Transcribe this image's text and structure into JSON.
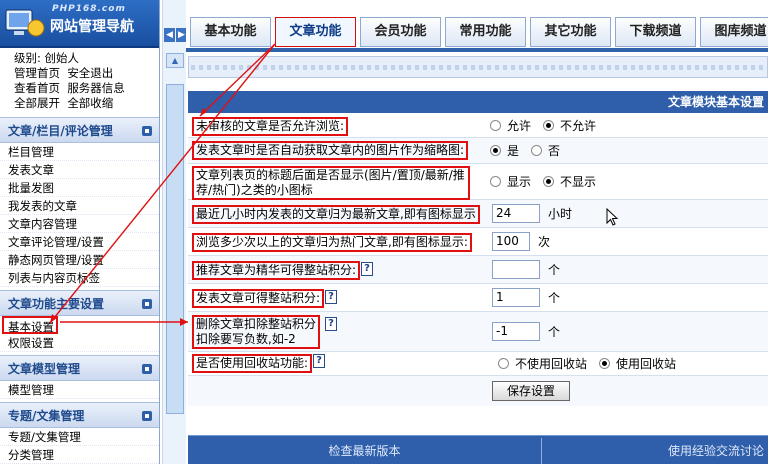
{
  "logo": {
    "site": "PHP168.com",
    "title": "网站管理导航"
  },
  "user": {
    "level_label": "级别: 创始人",
    "links_row1": [
      "管理首页",
      "安全退出"
    ],
    "links_row2": [
      "查看首页",
      "服务器信息"
    ],
    "links_row3": [
      "全部展开",
      "全部收缩"
    ]
  },
  "sidebar": {
    "sections": [
      {
        "title": "文章/栏目/评论管理",
        "items": [
          "栏目管理",
          "发表文章",
          "批量发图",
          "我发表的文章",
          "文章内容管理",
          "文章评论管理/设置",
          "静态网页管理/设置",
          "列表与内容页标签"
        ]
      },
      {
        "title": "文章功能主要设置",
        "items": [
          "基本设置",
          "权限设置"
        ]
      },
      {
        "title": "文章模型管理",
        "items": [
          "模型管理"
        ]
      },
      {
        "title": "专题/文集管理",
        "items": [
          "专题/文集管理",
          "分类管理"
        ]
      }
    ]
  },
  "tabs": [
    "基本功能",
    "文章功能",
    "会员功能",
    "常用功能",
    "其它功能",
    "下载频道",
    "图库频道"
  ],
  "active_tab_index": 1,
  "panel": {
    "title": "文章模块基本设置",
    "rows": [
      {
        "label": "未审核的文章是否允许浏览:",
        "type": "radio",
        "options": [
          "允许",
          "不允许"
        ],
        "selected": 1
      },
      {
        "label": "发表文章时是否自动获取文章内的图片作为缩略图:",
        "type": "radio",
        "options": [
          "是",
          "否"
        ],
        "selected": 0
      },
      {
        "label": "文章列表页的标题后面是否显示(图片/置顶/最新/推荐/热门)之类的小图标",
        "type": "radio",
        "options": [
          "显示",
          "不显示"
        ],
        "selected": 1
      },
      {
        "label": "最近几小时内发表的文章归为最新文章,即有图标显示",
        "type": "input",
        "value": "24",
        "unit": "小时"
      },
      {
        "label": "浏览多少次以上的文章归为热门文章,即有图标显示:",
        "type": "input",
        "value": "100",
        "unit": "次"
      },
      {
        "label": "推荐文章为精华可得整站积分:",
        "type": "input",
        "value": "",
        "unit": "个",
        "help": "?"
      },
      {
        "label": "发表文章可得整站积分:",
        "type": "input",
        "value": "1",
        "unit": "个",
        "help": "?"
      },
      {
        "label": "删除文章扣除整站积分",
        "label2": "扣除要写负数,如-2",
        "type": "input",
        "value": "-1",
        "unit": "个",
        "help": "?"
      },
      {
        "label": "是否使用回收站功能:",
        "type": "radio",
        "options": [
          "不使用回收站",
          "使用回收站"
        ],
        "selected": 1,
        "help": "?"
      }
    ],
    "save_button": "保存设置"
  },
  "footer": {
    "left": "检查最新版本",
    "right": "使用经验交流讨论"
  },
  "colors": {
    "accent": "#2f5fab",
    "highlight": "#e01010"
  }
}
